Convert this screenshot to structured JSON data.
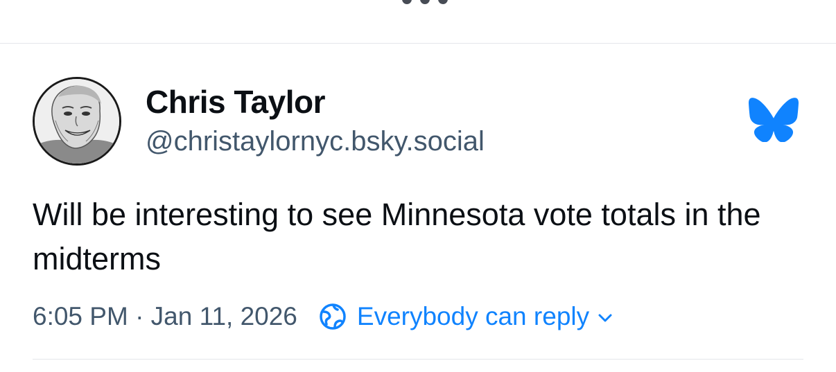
{
  "post": {
    "author_name": "Chris Taylor",
    "author_handle": "@christaylornyc.bsky.social",
    "text": "Will be interesting to see Minnesota vote totals in the midterms",
    "timestamp": "6:05 PM · Jan 11, 2026",
    "reply_setting": "Everybody can reply"
  },
  "icons": {
    "back": "chevron-left-icon",
    "logo": "bluesky-butterfly-icon",
    "reply_setting": "globe-icon",
    "dropdown": "chevron-down-icon"
  },
  "colors": {
    "accent": "#1083fe",
    "secondary_text": "#42576c",
    "primary_text": "#0b0f14",
    "divider": "#e4e6ea"
  }
}
